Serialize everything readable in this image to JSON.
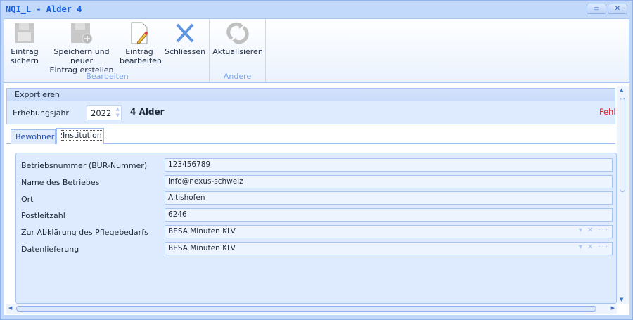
{
  "window": {
    "title": "NQI_L - Alder 4",
    "restore_icon": "restore-icon",
    "close_icon": "close-icon"
  },
  "ribbon": {
    "groups": [
      {
        "label": "Bearbeiten"
      },
      {
        "label": "Andere"
      }
    ],
    "buttons": [
      {
        "line1": "Eintrag",
        "line2": "sichern",
        "icon": "floppy-disk-icon"
      },
      {
        "line1": "Speichern und neuer",
        "line2": "Eintrag erstellen",
        "icon": "floppy-disk-add-icon"
      },
      {
        "line1": "Eintrag",
        "line2": "bearbeiten",
        "icon": "edit-document-icon"
      },
      {
        "line1": "Schliessen",
        "icon": "close-x-icon"
      },
      {
        "line1": "Aktualisieren",
        "icon": "refresh-icon"
      }
    ]
  },
  "export": {
    "header": "Exportieren",
    "year_label": "Erhebungsjahr",
    "year_value": "2022",
    "institution_name": "4 Alder",
    "error_text": "Fehle",
    "error_color": "#e8202a"
  },
  "tabs": [
    {
      "label": "Bewohner"
    },
    {
      "label": "Institution",
      "active": true
    }
  ],
  "fields": [
    {
      "label": "Betriebsnummer (BUR-Nummer)",
      "value": "123456789"
    },
    {
      "label": "Name des Betriebes",
      "value": "info@nexus-schweiz"
    },
    {
      "label": "Ort",
      "value": "Altishofen"
    },
    {
      "label": "Postleitzahl",
      "value": "6246"
    },
    {
      "label": "Zur Abklärung des Pflegebedarfs",
      "value": "BESA Minuten KLV",
      "dropdown": true
    },
    {
      "label": "Datenlieferung",
      "value": "BESA Minuten KLV",
      "dropdown": true
    }
  ]
}
